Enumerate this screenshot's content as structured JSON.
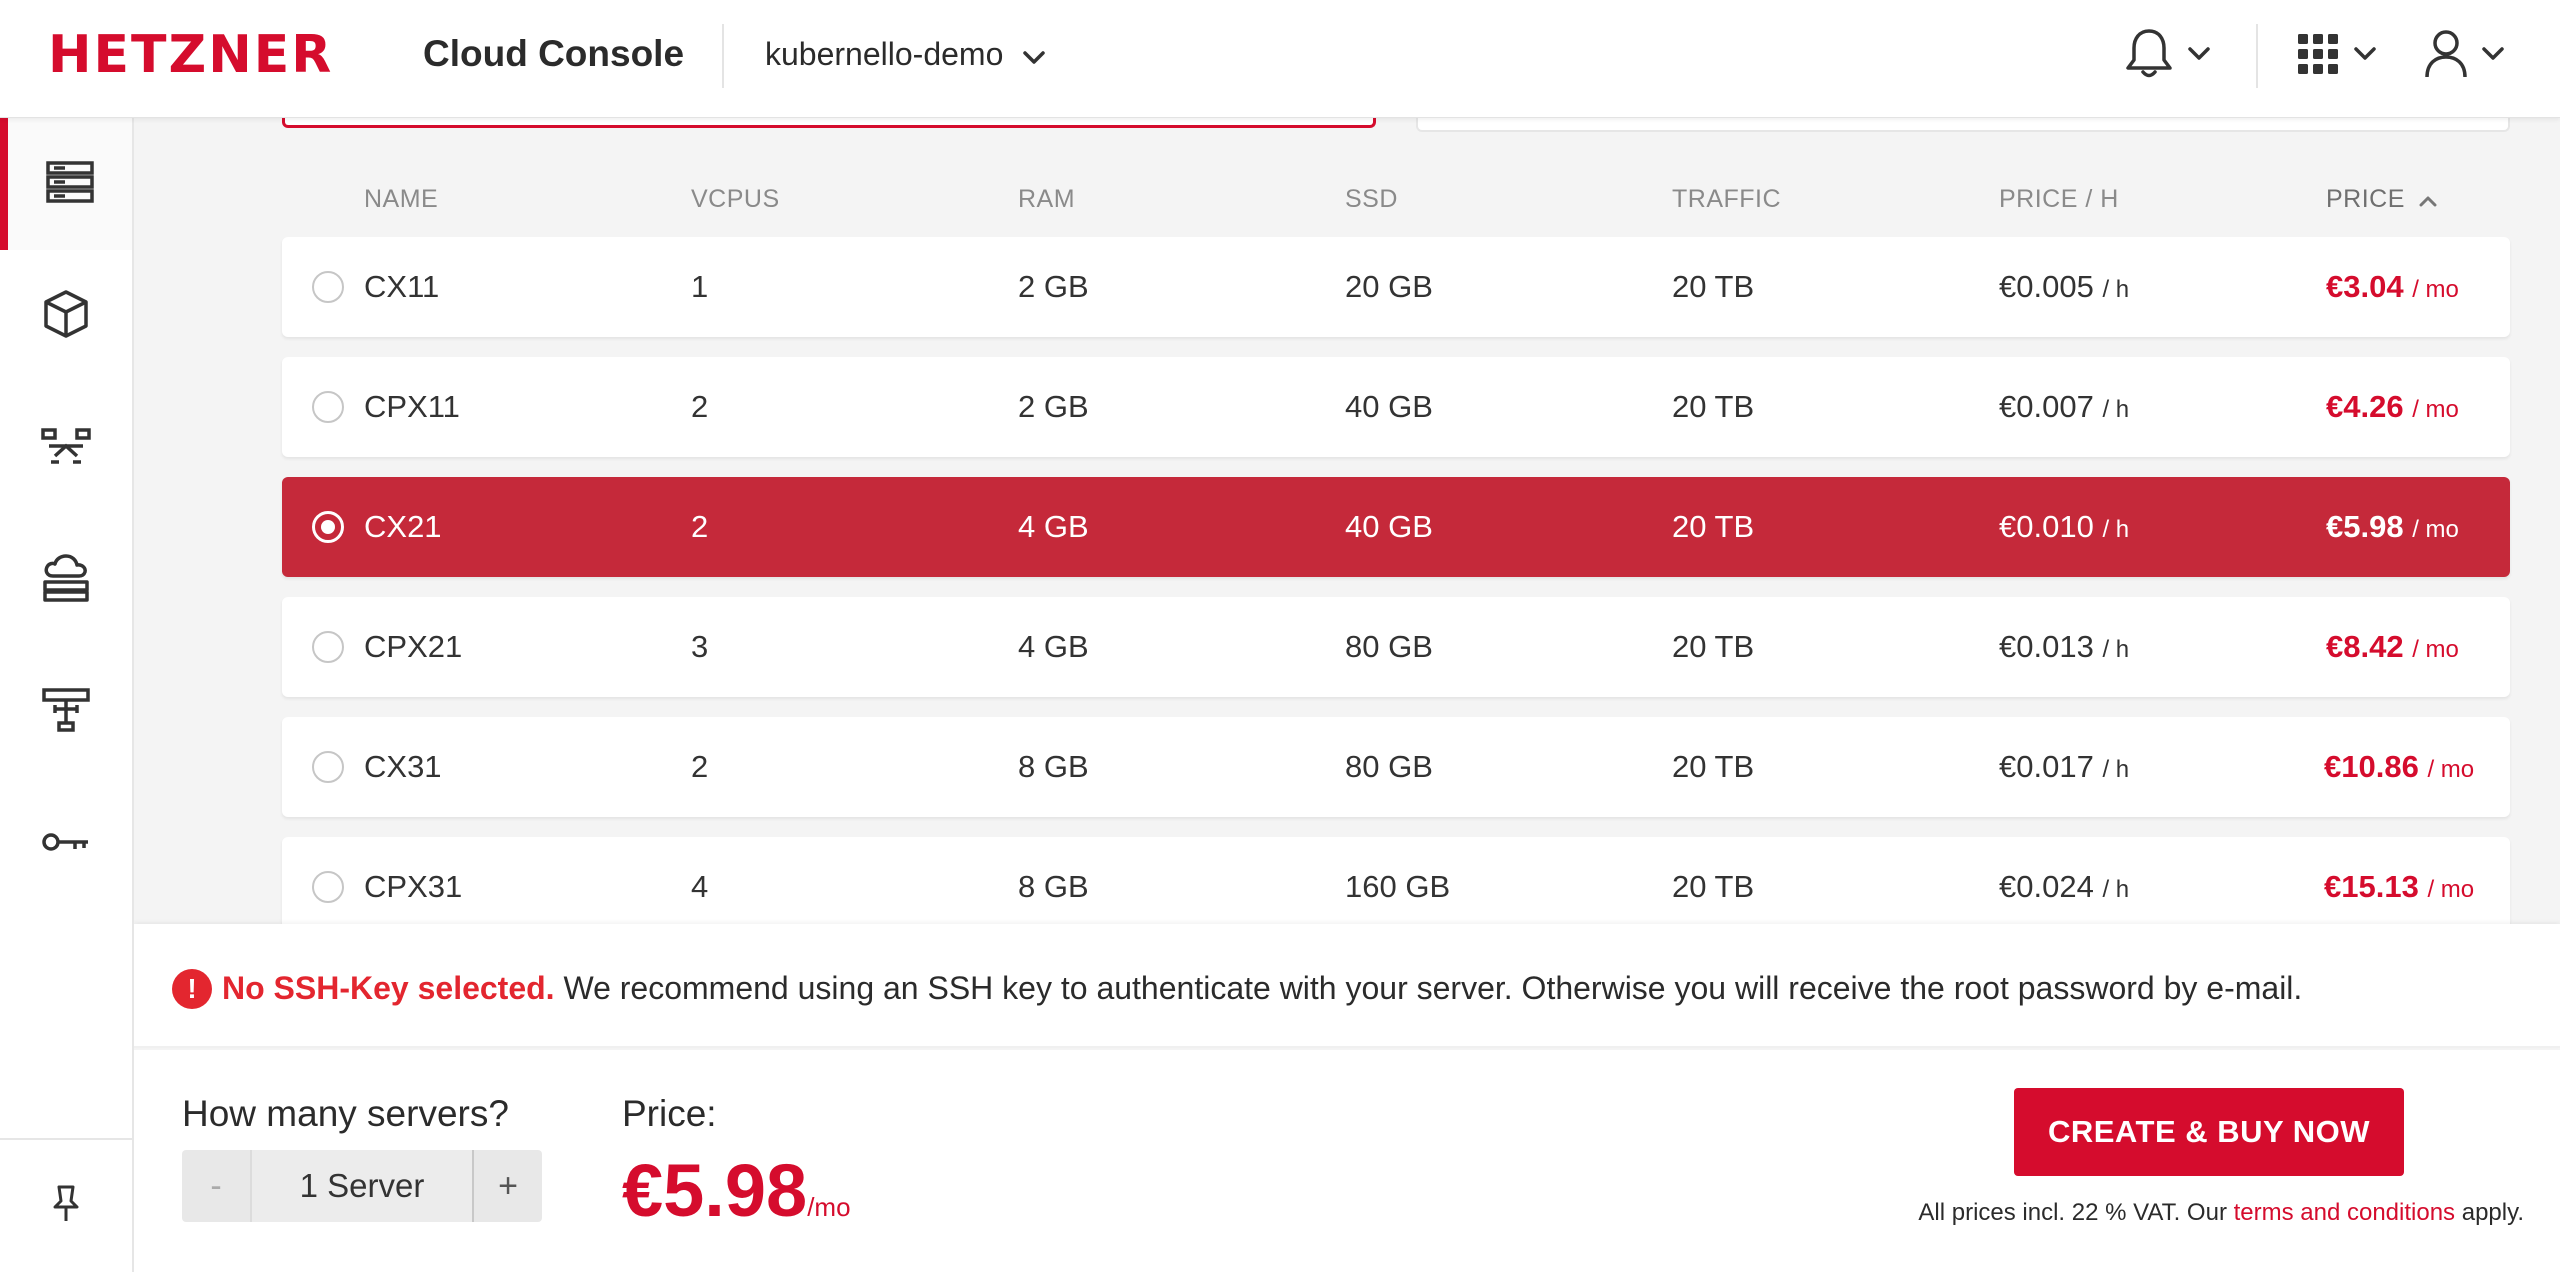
{
  "header": {
    "logo": "HETZNER",
    "product": "Cloud Console",
    "project": "kubernello-demo"
  },
  "sidebar": {
    "items": [
      {
        "icon": "servers-icon",
        "active": true
      },
      {
        "icon": "volumes-icon",
        "active": false
      },
      {
        "icon": "load-balancers-icon",
        "active": false
      },
      {
        "icon": "floating-ips-icon",
        "active": false
      },
      {
        "icon": "networks-icon",
        "active": false
      },
      {
        "icon": "ssh-keys-icon",
        "active": false
      }
    ],
    "pin_icon": "pin-icon"
  },
  "table": {
    "columns": [
      "NAME",
      "VCPUS",
      "RAM",
      "SSD",
      "TRAFFIC",
      "PRICE / H",
      "PRICE"
    ],
    "sorted_column": "PRICE",
    "rows": [
      {
        "name": "CX11",
        "vcpus": "1",
        "ram": "2 GB",
        "ssd": "20 GB",
        "traffic": "20 TB",
        "price_h": "€0.005",
        "price_h_unit": "/ h",
        "price_mo": "€3.04",
        "price_mo_unit": "/ mo",
        "selected": false
      },
      {
        "name": "CPX11",
        "vcpus": "2",
        "ram": "2 GB",
        "ssd": "40 GB",
        "traffic": "20 TB",
        "price_h": "€0.007",
        "price_h_unit": "/ h",
        "price_mo": "€4.26",
        "price_mo_unit": "/ mo",
        "selected": false
      },
      {
        "name": "CX21",
        "vcpus": "2",
        "ram": "4 GB",
        "ssd": "40 GB",
        "traffic": "20 TB",
        "price_h": "€0.010",
        "price_h_unit": "/ h",
        "price_mo": "€5.98",
        "price_mo_unit": "/ mo",
        "selected": true
      },
      {
        "name": "CPX21",
        "vcpus": "3",
        "ram": "4 GB",
        "ssd": "80 GB",
        "traffic": "20 TB",
        "price_h": "€0.013",
        "price_h_unit": "/ h",
        "price_mo": "€8.42",
        "price_mo_unit": "/ mo",
        "selected": false
      },
      {
        "name": "CX31",
        "vcpus": "2",
        "ram": "8 GB",
        "ssd": "80 GB",
        "traffic": "20 TB",
        "price_h": "€0.017",
        "price_h_unit": "/ h",
        "price_mo": "€10.86",
        "price_mo_unit": "/ mo",
        "selected": false
      },
      {
        "name": "CPX31",
        "vcpus": "4",
        "ram": "8 GB",
        "ssd": "160 GB",
        "traffic": "20 TB",
        "price_h": "€0.024",
        "price_h_unit": "/ h",
        "price_mo": "€15.13",
        "price_mo_unit": "/ mo",
        "selected": false
      }
    ]
  },
  "warning": {
    "icon": "!",
    "strong": "No SSH-Key selected.",
    "text": "We recommend using an SSH key to authenticate with your server. Otherwise you will receive the root password by e-mail."
  },
  "footer": {
    "qty_label": "How many servers?",
    "minus": "-",
    "quantity": "1 Server",
    "plus": "+",
    "price_label": "Price:",
    "price_value": "€5.98",
    "price_per": "/mo",
    "buy_button": "CREATE & BUY NOW",
    "vat_prefix": "All prices incl. 22 % VAT. Our",
    "vat_link": "terms and conditions",
    "vat_suffix": "apply."
  },
  "colors": {
    "brand": "#d50c2d",
    "selected_row": "#c5293a",
    "warning": "#e3262f"
  }
}
